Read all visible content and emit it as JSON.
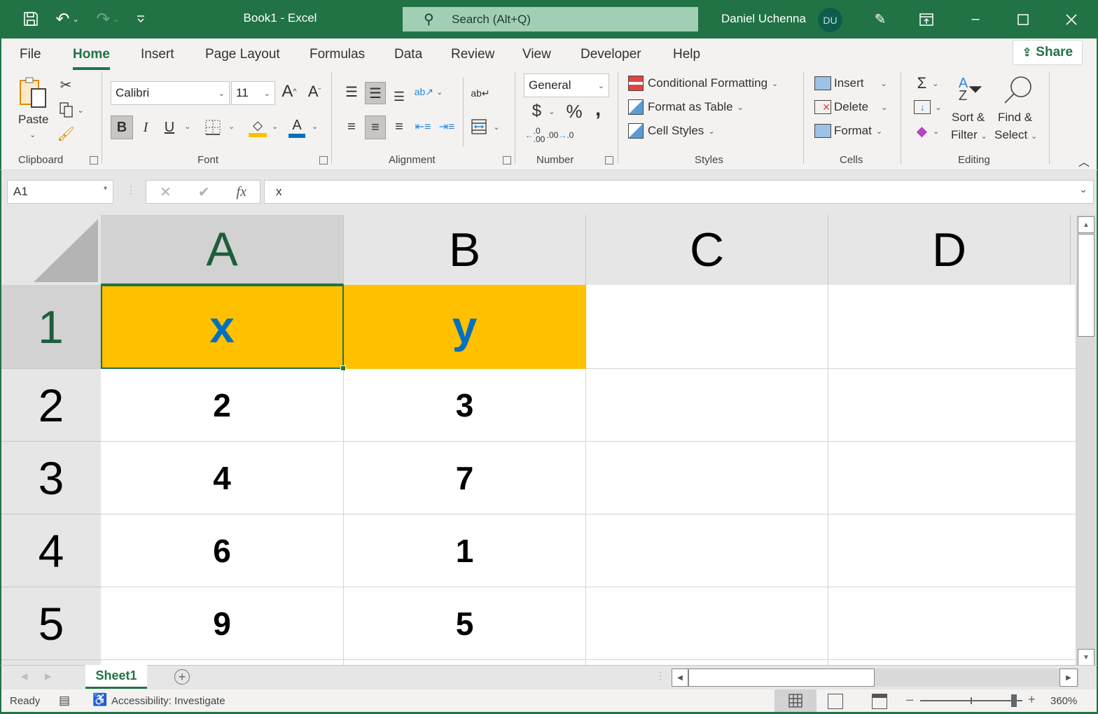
{
  "titlebar": {
    "doc_title": "Book1  -  Excel",
    "search_placeholder": "Search (Alt+Q)",
    "user_name": "Daniel Uchenna",
    "avatar_initials": "DU",
    "brand_color": "#217346"
  },
  "menu": {
    "tabs": [
      "File",
      "Home",
      "Insert",
      "Page Layout",
      "Formulas",
      "Data",
      "Review",
      "View",
      "Developer",
      "Help"
    ],
    "active_tab": "Home",
    "share_label": "Share"
  },
  "ribbon": {
    "clipboard": {
      "label": "Clipboard",
      "paste": "Paste"
    },
    "font": {
      "label": "Font",
      "font_name": "Calibri",
      "font_size": "11",
      "bold": "B",
      "italic": "I",
      "underline": "U",
      "fill_color": "#ffc000",
      "font_color": "#0070c0"
    },
    "alignment": {
      "label": "Alignment"
    },
    "number": {
      "label": "Number",
      "format": "General",
      "currency": "$",
      "percent": "%",
      "comma": ","
    },
    "styles": {
      "label": "Styles",
      "conditional": "Conditional Formatting",
      "format_table": "Format as Table",
      "cell_styles": "Cell Styles"
    },
    "cells": {
      "label": "Cells",
      "insert": "Insert",
      "delete": "Delete",
      "format": "Format"
    },
    "editing": {
      "label": "Editing",
      "sort1": "Sort &",
      "sort2": "Filter",
      "find1": "Find &",
      "find2": "Select"
    }
  },
  "formula_bar": {
    "name_box": "A1",
    "fx": "fx",
    "content": "x"
  },
  "sheet": {
    "columns": [
      "A",
      "B",
      "C",
      "D"
    ],
    "active_column": "A",
    "rows": [
      {
        "num": "1",
        "cells": [
          "x",
          "y",
          "",
          ""
        ]
      },
      {
        "num": "2",
        "cells": [
          "2",
          "3",
          "",
          ""
        ]
      },
      {
        "num": "3",
        "cells": [
          "4",
          "7",
          "",
          ""
        ]
      },
      {
        "num": "4",
        "cells": [
          "6",
          "1",
          "",
          ""
        ]
      },
      {
        "num": "5",
        "cells": [
          "9",
          "5",
          "",
          ""
        ]
      }
    ],
    "header_fill": "#ffc000",
    "header_text_color": "#0070c0"
  },
  "sheet_tabs": {
    "tabs": [
      "Sheet1"
    ],
    "active": "Sheet1"
  },
  "status_bar": {
    "ready": "Ready",
    "accessibility": "Accessibility: Investigate",
    "zoom": "360%",
    "zoom_value_percent": 360
  }
}
